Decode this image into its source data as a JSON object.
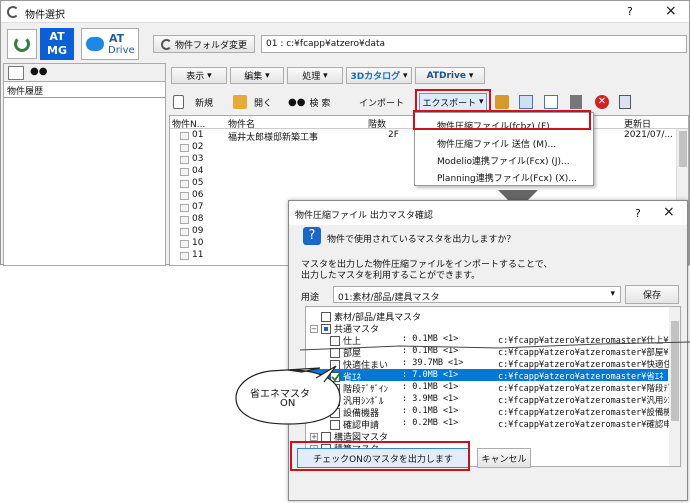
{
  "main_window": {
    "title": "物件選択",
    "help": "?",
    "close": "×",
    "logo_at": "AT",
    "logo_mg": "MG",
    "logo_drive_at": "AT",
    "logo_drive": "Drive",
    "folder_button": "物件フォルダ変更",
    "folder_path": "01 : c:¥fcapp¥atzero¥data",
    "left_tab_label": "物件履歴",
    "menu": [
      "表示",
      "編集",
      "処理",
      "3Dカタログ",
      "ATDrive"
    ],
    "toolbar": {
      "new": "新規",
      "open": "開く",
      "search": "検 索",
      "import": "インポート",
      "export": "エクスポート"
    },
    "columns": [
      "物件N...",
      "物件名",
      "階数",
      "更新日"
    ],
    "rows": [
      {
        "no": "01",
        "name": "福井太郎様邸新築工事",
        "floors": "2F",
        "date": "2021/07/..."
      },
      {
        "no": "02"
      },
      {
        "no": "03"
      },
      {
        "no": "04"
      },
      {
        "no": "05"
      },
      {
        "no": "06"
      },
      {
        "no": "07"
      },
      {
        "no": "08"
      },
      {
        "no": "09"
      },
      {
        "no": "10"
      },
      {
        "no": "11"
      }
    ],
    "export_menu": [
      "物件圧縮ファイル(fcbz) (F)...",
      "物件圧縮ファイル 送信 (M)...",
      "Modelio連携ファイル(Fcx) (J)...",
      "Planning連携ファイル(Fcx) (X)..."
    ]
  },
  "dialog": {
    "title": "物件圧縮ファイル 出力マスタ確認",
    "help": "?",
    "close": "×",
    "question": "物件で使用されているマスタを出力しますか？",
    "desc_line1": "マスタを出力した物件圧縮ファイルをインポートすることで、",
    "desc_line2": "出力したマスタを利用することができます。",
    "usage_label": "用途",
    "usage_value": "01:素材/部品/建具マスタ",
    "save_button": "保存",
    "tree": [
      {
        "label": "素材/部品/建具マスタ",
        "level": 0,
        "checked": false,
        "expander": ""
      },
      {
        "label": "共通マスタ",
        "level": 0,
        "checked": false,
        "expander": "−"
      },
      {
        "label": "仕上",
        "level": 1,
        "size": ":  0.1MB <1>",
        "path": "c:¥fcapp¥atzero¥atzeromaster¥仕上¥仕"
      },
      {
        "label": "部屋",
        "level": 1,
        "size": ":  0.1MB <1>",
        "path": "c:¥fcapp¥atzero¥atzeromaster¥部屋¥部"
      },
      {
        "label": "快適住まい",
        "level": 1,
        "size": ": 39.7MB <1>",
        "path": "c:¥fcapp¥atzero¥atzeromaster¥快適住ま"
      },
      {
        "label": "省ｴﾈ",
        "level": 1,
        "size": ":  7.0MB <1>",
        "path": "c:¥fcapp¥atzero¥atzeromaster¥省ｴﾈ",
        "checked": true,
        "selected": true
      },
      {
        "label": "階段ﾃﾞｻﾞｲﾝ",
        "level": 1,
        "size": ":  0.1MB <1>",
        "path": "c:¥fcapp¥atzero¥atzeromaster¥階段ﾃﾞｻﾞ"
      },
      {
        "label": "汎用ｼﾝﾎﾞﾙ",
        "level": 1,
        "size": ":  3.9MB <1>",
        "path": "c:¥fcapp¥atzero¥atzeromaster¥汎用ｼﾝﾎﾞ"
      },
      {
        "label": "設備機器",
        "level": 1,
        "size": ":  0.1MB <1>",
        "path": "c:¥fcapp¥atzero¥atzeromaster¥設備機器"
      },
      {
        "label": "確認申請",
        "level": 1,
        "size": ":  0.2MB <1>",
        "path": "c:¥fcapp¥atzero¥atzeromaster¥確認申請"
      },
      {
        "label": "構造図マスタ",
        "level": 0,
        "checked": false,
        "expander": "+"
      },
      {
        "label": "積算マスタ",
        "level": 0,
        "checked": false,
        "expander": "+"
      },
      {
        "label": "施工図マスタ",
        "level": 0,
        "checked": false,
        "expander": "+"
      }
    ],
    "ok_button": "チェックONのマスタを出力します",
    "cancel_button": "キャンセル"
  },
  "callout": {
    "line1": "省エネマスタ",
    "line2": "ON"
  },
  "colors": {
    "accent": "#0a5fd6",
    "highlight_red": "#d0101e",
    "selection": "#0078d7"
  }
}
